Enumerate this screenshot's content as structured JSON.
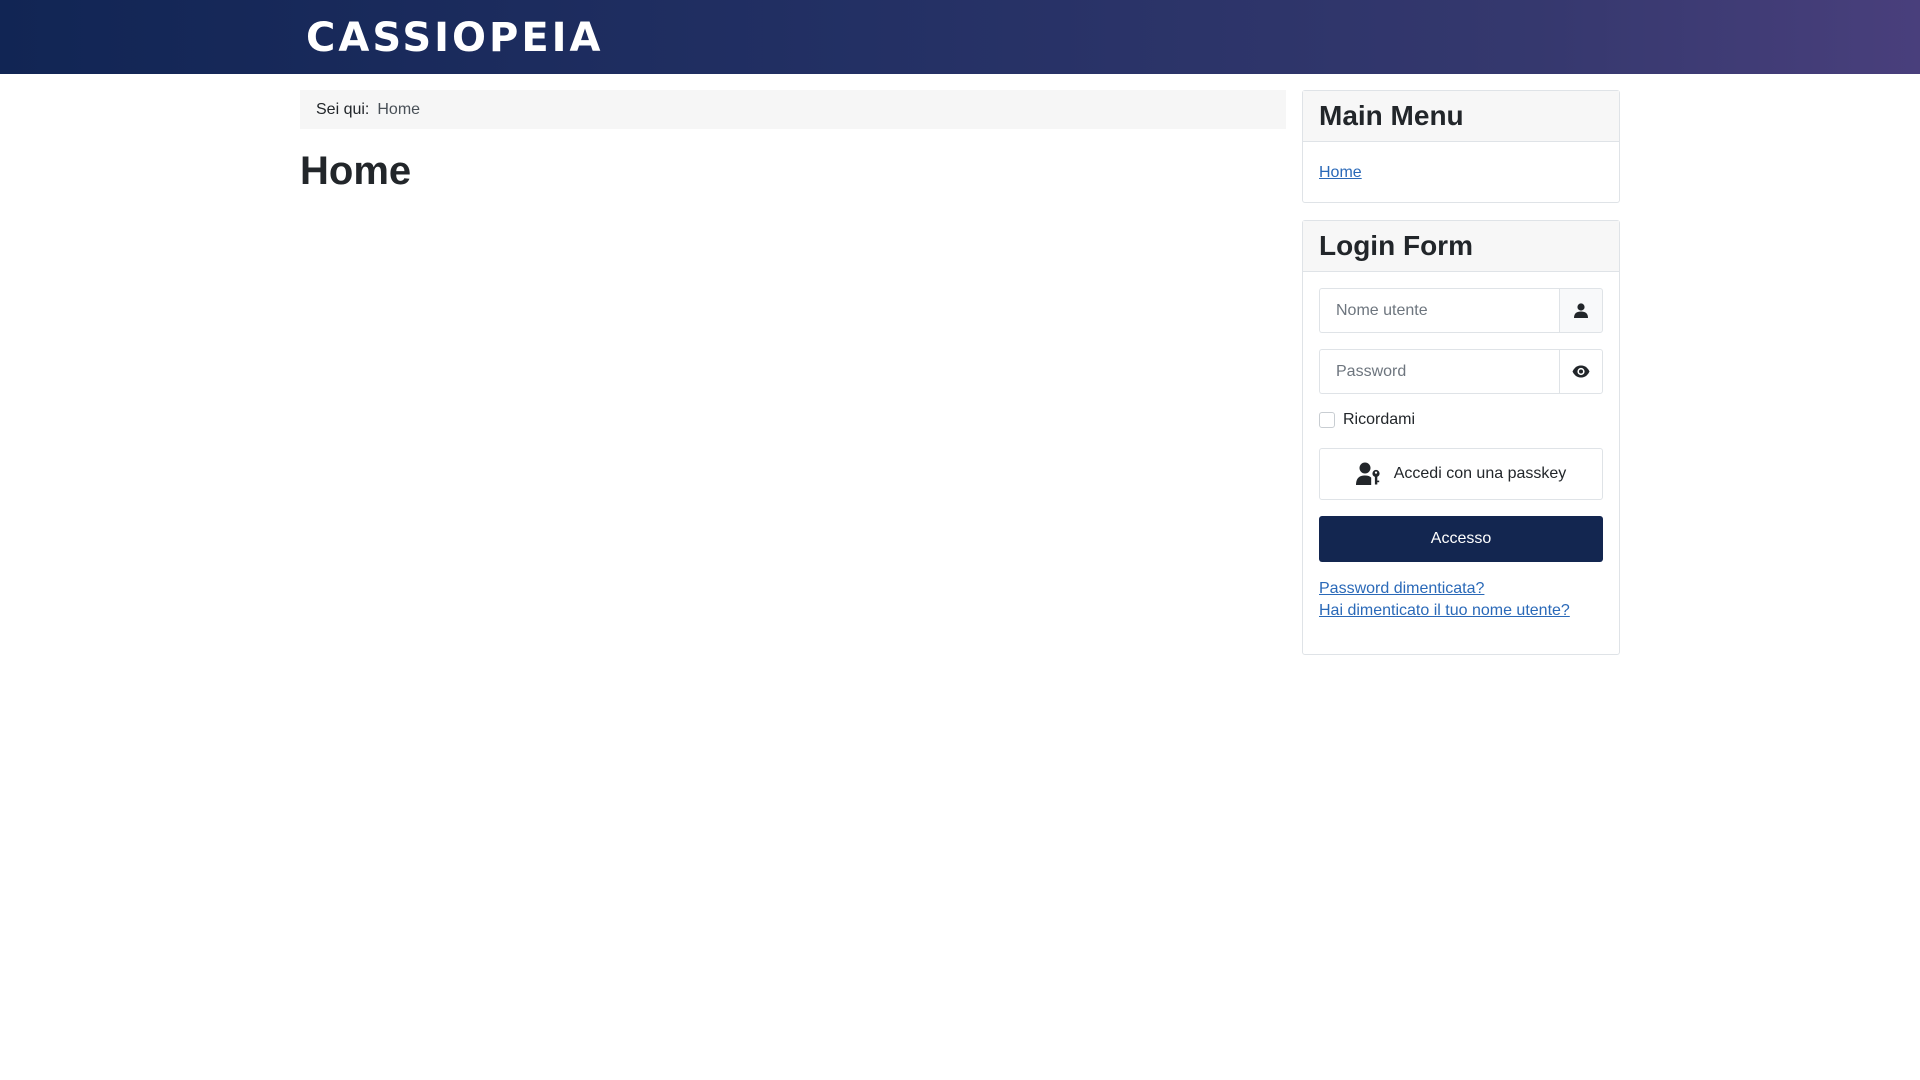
{
  "header": {
    "brand": "CASSIOPEIA",
    "gradient_start": "#112554",
    "gradient_end": "#493f7c"
  },
  "breadcrumb": {
    "lead": "Sei qui:",
    "items": [
      "Home"
    ]
  },
  "main": {
    "title": "Home"
  },
  "main_menu": {
    "title": "Main Menu",
    "items": [
      {
        "label": "Home",
        "active": false
      }
    ]
  },
  "login_form": {
    "title": "Login Form",
    "username": {
      "placeholder": "Nome utente",
      "value": "",
      "icon": "user-icon"
    },
    "password": {
      "placeholder": "Password",
      "value": "",
      "icon": "eye-icon"
    },
    "remember": {
      "label": "Ricordami",
      "checked": false
    },
    "passkey_button": {
      "label": "Accedi con una passkey",
      "icon": "user-key-icon"
    },
    "submit_button": {
      "label": "Accesso",
      "color": "#132650"
    },
    "links": {
      "forgot_password": "Password dimenticata?",
      "forgot_username": "Hai dimenticato il tuo nome utente?"
    }
  },
  "colors": {
    "link": "#2a69b8",
    "text": "#22262a"
  }
}
